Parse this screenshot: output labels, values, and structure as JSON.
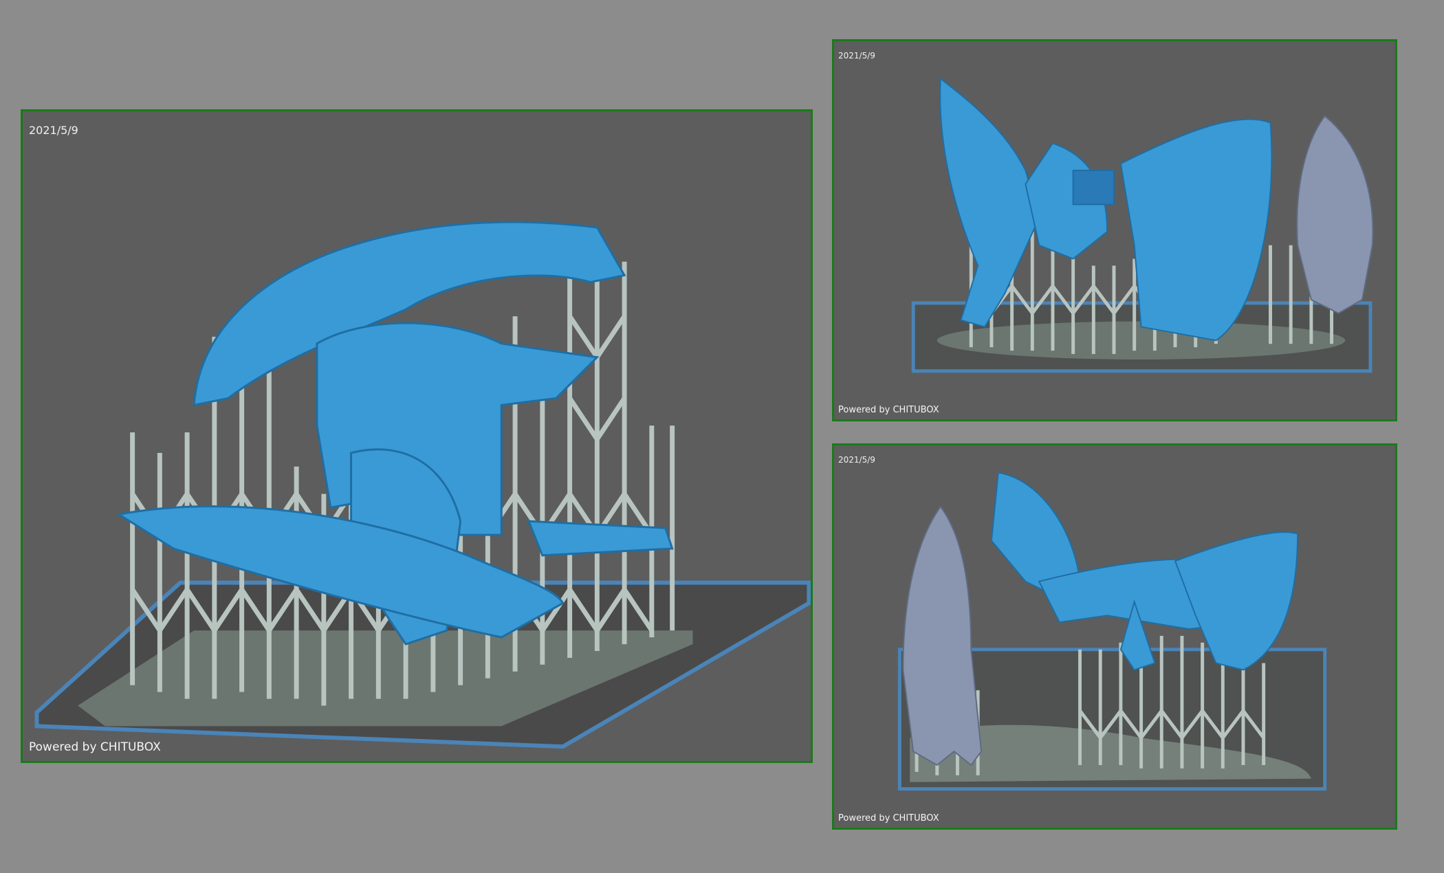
{
  "viewports": [
    {
      "id": "main",
      "date": "2021/5/9",
      "credit": "Powered by CHITUBOX"
    },
    {
      "id": "top-right",
      "date": "2021/5/9",
      "credit": "Powered by CHITUBOX"
    },
    {
      "id": "bottom-right",
      "date": "2021/5/9",
      "credit": "Powered by CHITUBOX"
    }
  ],
  "colors": {
    "background": "#8c8c8c",
    "viewport_bg": "#5d5d5d",
    "viewport_border": "#1a7a1a",
    "model_blue": "#3a9ad6",
    "support_gray": "#b8c4bf",
    "plate_blue": "#4a84b8",
    "figure_gray": "#8a96b0"
  }
}
